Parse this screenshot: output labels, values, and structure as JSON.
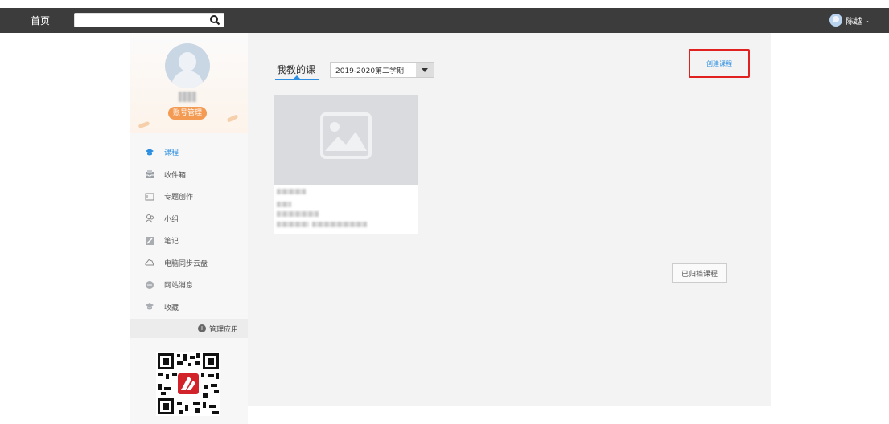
{
  "topbar": {
    "home_label": "首页",
    "search": {
      "value": "",
      "placeholder": ""
    },
    "user_name": "陈越"
  },
  "sidebar": {
    "account_button": "账号管理",
    "menu": [
      {
        "label": "课程",
        "icon": "course-icon",
        "active": true
      },
      {
        "label": "收件箱",
        "icon": "inbox-icon"
      },
      {
        "label": "专题创作",
        "icon": "topic-icon"
      },
      {
        "label": "小组",
        "icon": "group-icon"
      },
      {
        "label": "笔记",
        "icon": "note-icon"
      },
      {
        "label": "电脑同步云盘",
        "icon": "cloud-icon"
      },
      {
        "label": "网站消息",
        "icon": "message-icon"
      },
      {
        "label": "收藏",
        "icon": "favorite-icon"
      }
    ],
    "manage_apps": "管理应用"
  },
  "main": {
    "tab_title": "我教的课",
    "term_select": "2019-2020第二学期",
    "create_button": "创建课程",
    "archived_button": "已归档课程"
  },
  "colors": {
    "accent": "#2b8ee0",
    "highlight_border": "#e12020",
    "account_button": "#f39a53",
    "topbar": "#3c3c3c"
  }
}
